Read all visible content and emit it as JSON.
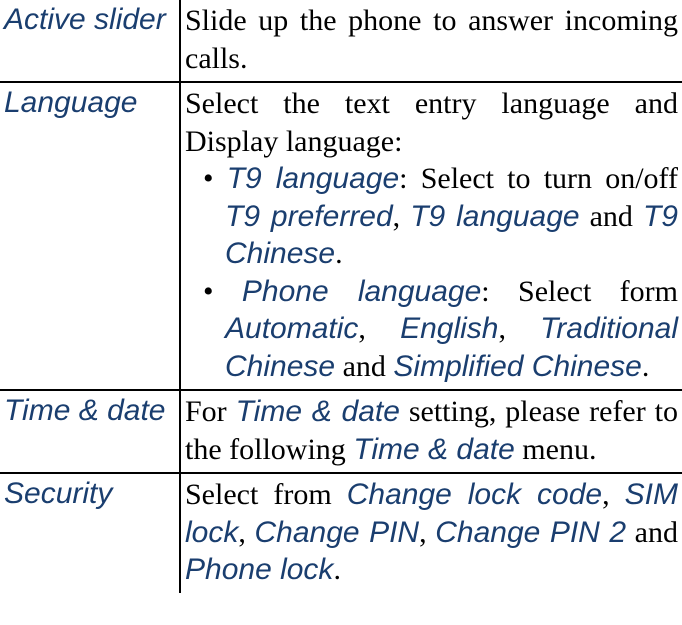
{
  "rows": {
    "active_slider": {
      "label": "Active slider",
      "desc": "Slide up the phone to answer incoming calls."
    },
    "language": {
      "label": "Language",
      "intro": "Select the text entry language and Display language:",
      "b1_kw1": "T9 language",
      "b1_txt1": ": Select to turn on/off ",
      "b1_kw2": "T9 preferred",
      "b1_sep1": ", ",
      "b1_kw3": "T9 language",
      "b1_txt2": " and ",
      "b1_kw4": "T9 Chinese",
      "b1_end": ".",
      "b2_pre": " ",
      "b2_kw1": "Phone language",
      "b2_txt1": ": Select form ",
      "b2_kw2": "Automatic",
      "b2_sep1": ", ",
      "b2_kw3": "English",
      "b2_sep2": ", ",
      "b2_kw4": "Traditional Chinese",
      "b2_txt2": " and ",
      "b2_kw5": "Simplified Chinese",
      "b2_end": "."
    },
    "time_date": {
      "label": "Time & date",
      "pre": "For ",
      "kw1": "Time & date",
      "mid": " setting, please refer to the following ",
      "kw2": "Time & date",
      "post": " menu."
    },
    "security": {
      "label": "Security",
      "pre": "Select from ",
      "kw1": "Change lock code",
      "sep1": ", ",
      "kw2": "SIM lock",
      "sep2": ", ",
      "kw3": "Change PIN",
      "sep3": ", ",
      "kw4": "Change PIN 2",
      "mid": " and ",
      "kw5": "Phone lock",
      "post": "."
    }
  }
}
